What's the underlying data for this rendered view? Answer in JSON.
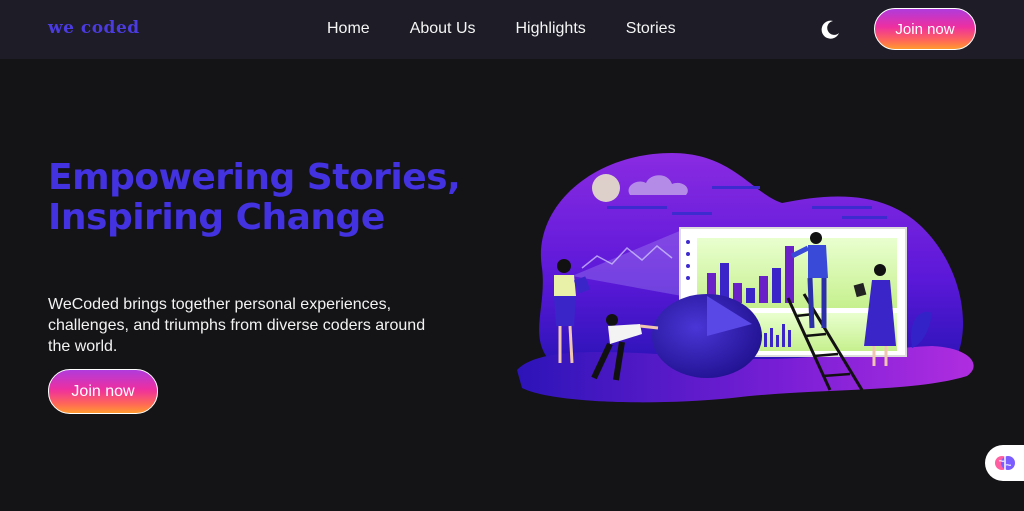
{
  "brand": {
    "logo_text": "we coded",
    "accent": "#4332e0"
  },
  "nav": {
    "links": [
      "Home",
      "About Us",
      "Highlights",
      "Stories"
    ],
    "theme_toggle_icon": "moon-icon",
    "join_label": "Join now"
  },
  "hero": {
    "title": "Empowering Stories, Inspiring Change",
    "description": "WeCoded brings together personal experiences, challenges, and triumphs from diverse coders around the world.",
    "join_label": "Join now",
    "illustration": "team-analytics-illustration"
  },
  "assistant": {
    "icon": "brain-icon"
  },
  "colors": {
    "background": "#141316",
    "nav_background": "#1d1c27",
    "button_gradient": [
      "#b03bdc",
      "#ee2fa0",
      "#ff6a55",
      "#ff9a2f"
    ]
  }
}
